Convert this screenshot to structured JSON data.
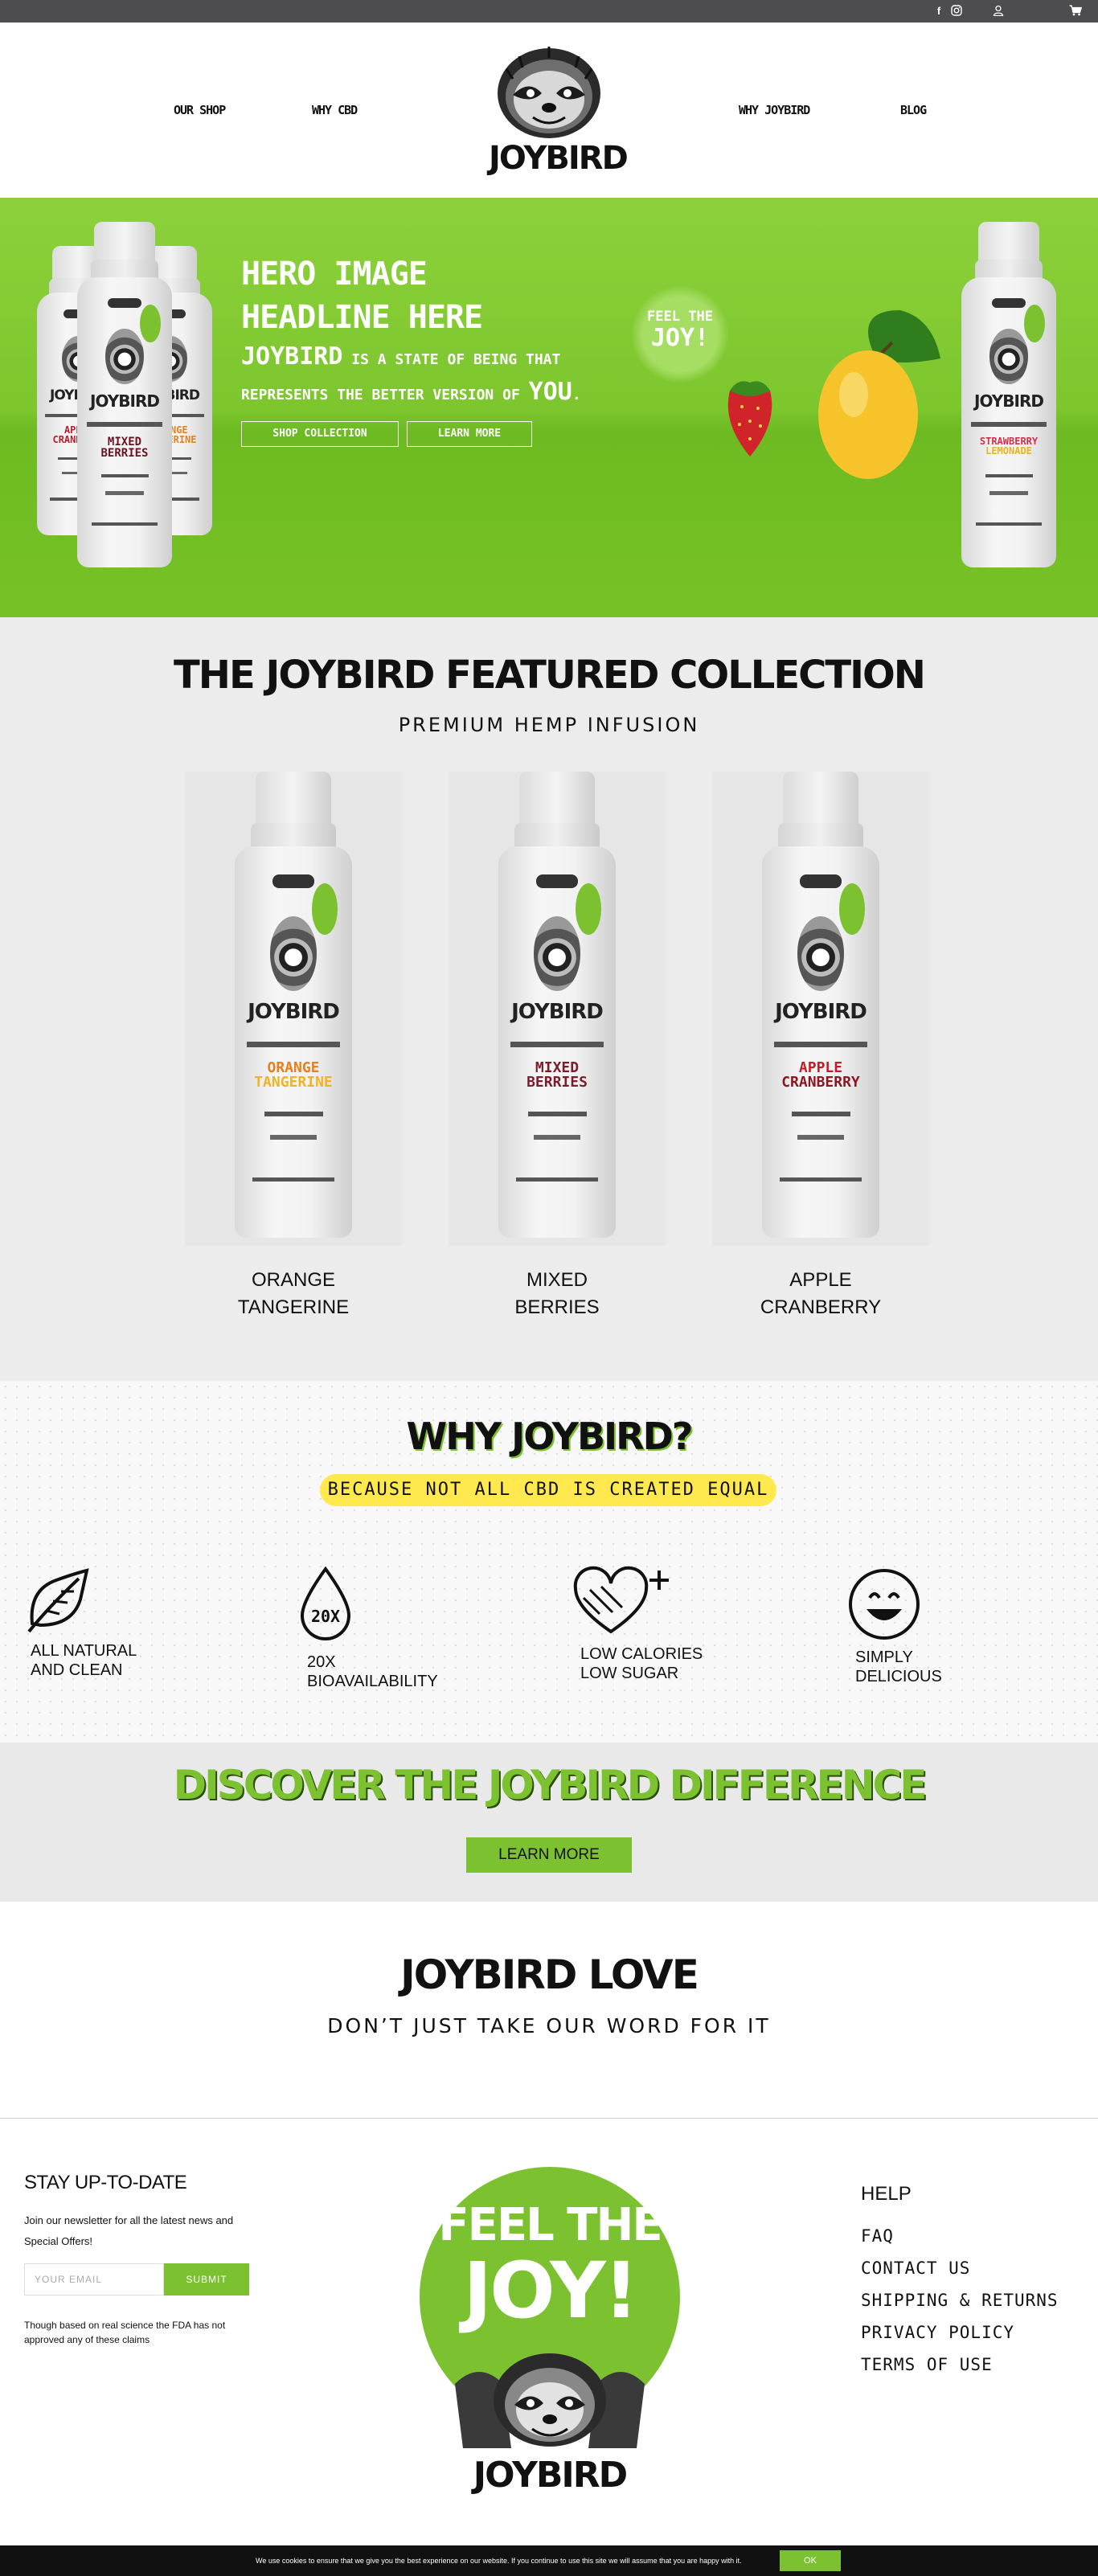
{
  "topbar": {
    "icons": [
      "facebook-icon",
      "instagram-icon",
      "user-icon",
      "cart-icon"
    ]
  },
  "header": {
    "nav": [
      "Our Shop",
      "Why CBD",
      "Why Joybird",
      "Blog"
    ],
    "logo_text": "JOYBIRD"
  },
  "hero": {
    "headline": "HERO IMAGE HEADLINE HERE",
    "sub_brand": "JOYBIRD",
    "sub_mid": " IS A STATE OF BEING THAT REPRESENTS THE BETTER VERSION OF ",
    "sub_end": "YOU",
    "sub_period": ".",
    "btn_shop": "SHOP COLLECTION",
    "btn_learn": "LEARN MORE",
    "bubble_line1": "FEEL THE",
    "bubble_line2": "JOY!",
    "bottles": [
      {
        "brand": "JOYBIRD",
        "flavor_top": "APPLE",
        "flavor_bottom": "CRANBERRY",
        "color": "#b5202b"
      },
      {
        "brand": "JOYBIRD",
        "flavor_top": "MIXED",
        "flavor_bottom": "BERRIES",
        "color": "#6b1320"
      },
      {
        "brand": "JOYBIRD",
        "flavor_top": "ORANGE",
        "flavor_bottom": "TANGERINE",
        "color": "#e6801e"
      },
      {
        "brand": "JOYBIRD",
        "flavor_top": "STRAWBERRY",
        "flavor_bottom": "LEMONADE",
        "color": "#d0304a"
      }
    ]
  },
  "featured": {
    "title": "THE JOYBIRD FEATURED COLLECTION",
    "subtitle": "PREMIUM HEMP INFUSION",
    "products": [
      {
        "line1": "ORANGE",
        "line2": "TANGERINE",
        "brand": "JOYBIRD",
        "color_top": "#e6801e",
        "color_bottom": "#f0b323"
      },
      {
        "line1": "MIXED",
        "line2": "BERRIES",
        "brand": "JOYBIRD",
        "color_top": "#7b1d2c",
        "color_bottom": "#7b1d2c"
      },
      {
        "line1": "APPLE",
        "line2": "CRANBERRY",
        "brand": "JOYBIRD",
        "color_top": "#c21e2a",
        "color_bottom": "#8b1722"
      }
    ]
  },
  "why": {
    "title": "WHY JOYBIRD?",
    "pill": "BECAUSE NOT ALL CBD IS CREATED EQUAL",
    "features": [
      {
        "icon": "leaf-icon",
        "line1": "ALL NATURAL",
        "line2": "AND CLEAN"
      },
      {
        "icon": "drop-icon",
        "icon_text": "20X",
        "line1": "20X",
        "line2": "BIOAVAILABILITY"
      },
      {
        "icon": "heart-plus-icon",
        "line1": "LOW CALORIES",
        "line2": "LOW SUGAR"
      },
      {
        "icon": "smiley-icon",
        "line1": "SIMPLY",
        "line2": "DELICIOUS"
      }
    ]
  },
  "discover": {
    "title": "DISCOVER THE JOYBIRD DIFFERENCE",
    "button": "LEARN MORE"
  },
  "love": {
    "title": "JOYBIRD LOVE",
    "subtitle": "DON’T JUST TAKE OUR WORD FOR IT"
  },
  "footer": {
    "stay_title": "STAY UP-TO-DATE",
    "newsletter_text": "Join our newsletter for all the latest news and Special Offers!",
    "email_placeholder": "YOUR EMAIL",
    "submit": "SUBMIT",
    "fda_text": "Though based on real science the FDA has not approved any of these claims",
    "badge_line1": "FEEL THE",
    "badge_line2": "JOY!",
    "badge_brand": "JOYBIRD",
    "help_title": "HELP",
    "help_links": [
      "FAQ",
      "CONTACT US",
      "SHIPPING & RETURNS",
      "PRIVACY POLICY",
      "TERMS OF USE"
    ]
  },
  "cookie": {
    "text": "We use cookies to ensure that we give you the best experience on our website. If you continue to use this site we will assume that you are happy with it.",
    "ok": "OK"
  },
  "colors": {
    "brand_green": "#7cc12f",
    "topbar": "#4d4d4f",
    "highlight_yellow": "#ffe94f"
  }
}
